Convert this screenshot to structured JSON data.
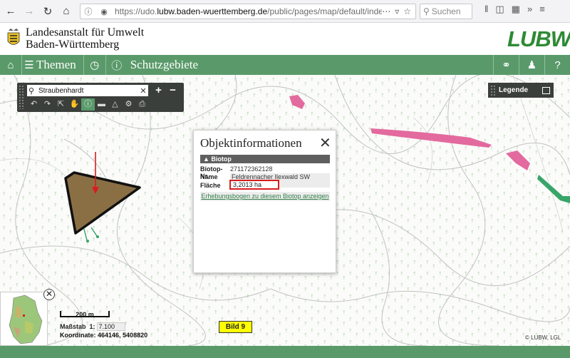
{
  "browser": {
    "url_prefix": "https://udo.",
    "url_domain": "lubw.baden-wuerttemberg.de",
    "url_path": "/public/pages/map/default/index.xhtml",
    "search_placeholder": "Suchen"
  },
  "header": {
    "org_line1": "Landesanstalt für Umwelt",
    "org_line2": "Baden-Württemberg",
    "brand": "LUBW"
  },
  "toolbar": {
    "themen_label": "Themen",
    "schutzgebiete_label": "Schutzgebiete"
  },
  "map_toolbar": {
    "search_value": "Straubenhardt"
  },
  "legend": {
    "label": "Legende"
  },
  "popup": {
    "title": "Objektinformationen",
    "section": "Biotop",
    "rows": [
      {
        "key": "Biotop-Nr.",
        "value": "271172362128"
      },
      {
        "key": "Name",
        "value": "Feldrennacher Ilexwald SW Conweiler"
      },
      {
        "key": "Fläche",
        "value": "3,2013 ha"
      }
    ],
    "link": "Erhebungsbogen zu diesem Biotop anzeigen"
  },
  "map_info": {
    "scale_label": "200 m",
    "massstab_label": "Maßstab",
    "massstab_prefix": "1:",
    "massstab_value": "7.100",
    "coords_label": "Koordinate:",
    "coords_value": "464146, 5408820",
    "bild_label": "Bild 9",
    "copyright": "© LUBW, LGL"
  },
  "colors": {
    "accent_green": "#5a9a6a",
    "biotope_fill": "#8a6f45",
    "highlight_red": "#d91d1d",
    "pink_area": "#e36a9e"
  }
}
